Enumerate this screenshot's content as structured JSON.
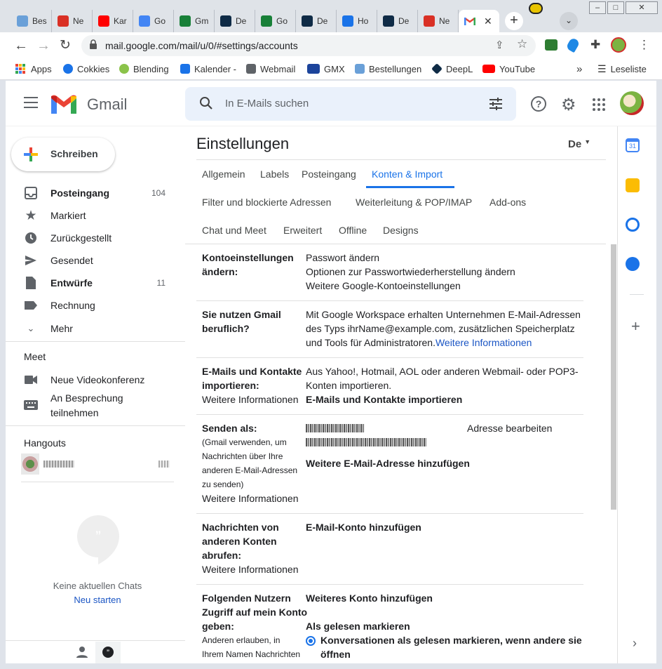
{
  "browser": {
    "tabs": [
      {
        "label": "Bes",
        "color": "#6aa0d8"
      },
      {
        "label": "Ne",
        "color": "#d93025"
      },
      {
        "label": "Kar",
        "color": "#ff0000"
      },
      {
        "label": "Go",
        "color": "#4285f4"
      },
      {
        "label": "Gm",
        "color": "#188038"
      },
      {
        "label": "De",
        "color": "#0f2b46"
      },
      {
        "label": "Go",
        "color": "#188038"
      },
      {
        "label": "De",
        "color": "#0f2b46"
      },
      {
        "label": "Ho",
        "color": "#1a73e8"
      },
      {
        "label": "De",
        "color": "#0f2b46"
      },
      {
        "label": "Ne",
        "color": "#d93025"
      }
    ],
    "active_tab_close": "✕",
    "new_tab": "+",
    "url": "mail.google.com/mail/u/0/#settings/accounts",
    "bookmarks": [
      {
        "label": "Apps",
        "color": "#ea4335"
      },
      {
        "label": "Cokkies",
        "color": "#1a73e8"
      },
      {
        "label": "Blending",
        "color": "#8bc34a"
      },
      {
        "label": "Kalender -",
        "color": "#1a73e8"
      },
      {
        "label": "Webmail",
        "color": "#5f6368"
      },
      {
        "label": "GMX",
        "color": "#1c449b"
      },
      {
        "label": "Bestellungen",
        "color": "#6aa0d8"
      },
      {
        "label": "DeepL",
        "color": "#0f2b46"
      },
      {
        "label": "YouTube",
        "color": "#ff0000"
      }
    ],
    "more_bookmarks": "»",
    "reading_list": "Leseliste"
  },
  "gmail": {
    "logo_text": "Gmail",
    "search_placeholder": "In E-Mails suchen",
    "compose": "Schreiben",
    "nav": [
      {
        "label": "Posteingang",
        "count": "104",
        "bold": true,
        "icon": "inbox-icon"
      },
      {
        "label": "Markiert",
        "count": "",
        "bold": false,
        "icon": "star-icon"
      },
      {
        "label": "Zurückgestellt",
        "count": "",
        "bold": false,
        "icon": "clock-icon"
      },
      {
        "label": "Gesendet",
        "count": "",
        "bold": false,
        "icon": "send-icon"
      },
      {
        "label": "Entwürfe",
        "count": "11",
        "bold": true,
        "icon": "draft-icon"
      },
      {
        "label": "Rechnung",
        "count": "",
        "bold": false,
        "icon": "label-icon"
      },
      {
        "label": "Mehr",
        "count": "",
        "bold": false,
        "icon": "chevron-down-icon"
      }
    ],
    "meet": {
      "heading": "Meet",
      "new_meeting": "Neue Videokonferenz",
      "join_line1": "An Besprechung",
      "join_line2": "teilnehmen"
    },
    "hangouts": {
      "heading": "Hangouts",
      "empty": "Keine aktuellen Chats",
      "start": "Neu starten"
    },
    "settings": {
      "title": "Einstellungen",
      "lang": "De",
      "tabs_row1": [
        "Allgemein",
        "Labels",
        "Posteingang",
        "Konten & Import"
      ],
      "tabs_row2": [
        "Filter und blockierte Adressen",
        "Weiterleitung & POP/IMAP",
        "Add-ons"
      ],
      "tabs_row3": [
        "Chat und Meet",
        "Erweitert",
        "Offline",
        "Designs"
      ],
      "rows": {
        "account": {
          "title1": "Kontoeinstellungen",
          "title2": "ändern:",
          "link1": "Passwort ändern",
          "link2": "Optionen zur Passwortwiederherstellung ändern",
          "link3": "Weitere Google-Kontoeinstellungen"
        },
        "business": {
          "title1": "Sie nutzen Gmail",
          "title2": "beruflich?",
          "line1": "Mit Google Workspace erhalten Unternehmen E-Mail-Adressen",
          "line2": "des Typs ihrName@example.com, zusätzlichen Speicherplatz",
          "line3": "und Tools für Administratoren.",
          "link": "Weitere Informationen"
        },
        "import": {
          "title1": "E-Mails und Kontakte",
          "title2": "importieren:",
          "learn": "Weitere Informationen",
          "line1": "Aus Yahoo!, Hotmail, AOL oder anderen Webmail- oder POP3-",
          "line2": "Konten importieren.",
          "action": "E-Mails und Kontakte importieren"
        },
        "sendas": {
          "title": "Senden als:",
          "desc1": "(Gmail verwenden, um",
          "desc2": "Nachrichten über Ihre",
          "desc3": "anderen E-Mail-Adressen",
          "desc4": "zu senden)",
          "learn": "Weitere Informationen",
          "edit": "Adresse bearbeiten",
          "add": "Weitere E-Mail-Adresse hinzufügen"
        },
        "fetch": {
          "title1": "Nachrichten von",
          "title2": "anderen Konten",
          "title3": "abrufen:",
          "learn": "Weitere Informationen",
          "action": "E-Mail-Konto hinzufügen"
        },
        "delegate": {
          "title1": "Folgenden Nutzern",
          "title2": "Zugriff auf mein Konto",
          "title3": "geben:",
          "desc1": "Anderen erlauben, in",
          "desc2": "Ihrem Namen Nachrichten",
          "action": "Weiteres Konto hinzufügen",
          "mark_heading": "Als gelesen markieren",
          "option1_line1": "Konversationen als gelesen markieren, wenn andere sie",
          "option1_line2": "öffnen"
        }
      }
    },
    "side_panel": {
      "calendar_day": "31"
    }
  }
}
